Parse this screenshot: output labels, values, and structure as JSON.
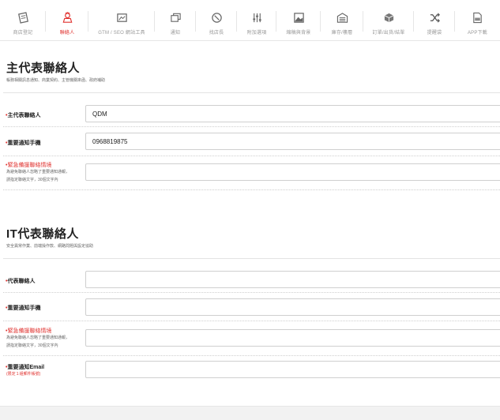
{
  "nav": {
    "items": [
      {
        "label": "商店登記",
        "icon": "store-register-icon"
      },
      {
        "label": "聯絡人",
        "icon": "contact-person-icon",
        "active": true
      },
      {
        "label": "GTM / SEO 網站工具",
        "icon": "gtm-seo-icon"
      },
      {
        "label": "通知",
        "icon": "notification-icon"
      },
      {
        "label": "找店長",
        "icon": "find-manager-icon"
      },
      {
        "label": "附加選項",
        "icon": "add-options-icon"
      },
      {
        "label": "縮稿與背景",
        "icon": "thumbnail-background-icon"
      },
      {
        "label": "庫存/樓層",
        "icon": "warehouse-icon"
      },
      {
        "label": "訂單/出貨/結單",
        "icon": "order-shipping-icon"
      },
      {
        "label": "提醒袋",
        "icon": "shuffle-icon"
      },
      {
        "label": "APP下載",
        "icon": "app-download-icon"
      }
    ],
    "accent_color": "#e0322f"
  },
  "main_contact": {
    "title": "主代表聯絡人",
    "subtitle": "帳務相關訊息通知、商業契約、主管機關來函、政府補助",
    "rows": [
      {
        "bullet": "•",
        "label": "主代表聯絡人",
        "value": "QDM"
      },
      {
        "bullet": "•",
        "label": "重要通知手機",
        "value": "0968819875"
      },
      {
        "bullet": "•",
        "label": "緊急備援聯絡情境",
        "note1": "為避免聯絡人忽略了重要通知通報，",
        "note2": "請指定聯絡文字，30個文字內",
        "value": ""
      }
    ]
  },
  "it_contact": {
    "title": "IT代表聯絡人",
    "subtitle": "安全異常作業、前端操作款、網路問題與設定協助",
    "rows": [
      {
        "bullet": "•",
        "label": "代表聯絡人",
        "value": ""
      },
      {
        "bullet": "•",
        "label": "重要通知手機",
        "value": ""
      },
      {
        "bullet": "•",
        "label": "緊急備援聯絡情境",
        "note1": "為避免聯絡人忽略了重要通知通報，",
        "note2": "請指定聯絡文字，30個文字內",
        "value": ""
      },
      {
        "bullet": "•",
        "label": "重要通知Email",
        "note_red": "(限定１組郵件帳號)",
        "value": ""
      }
    ]
  }
}
